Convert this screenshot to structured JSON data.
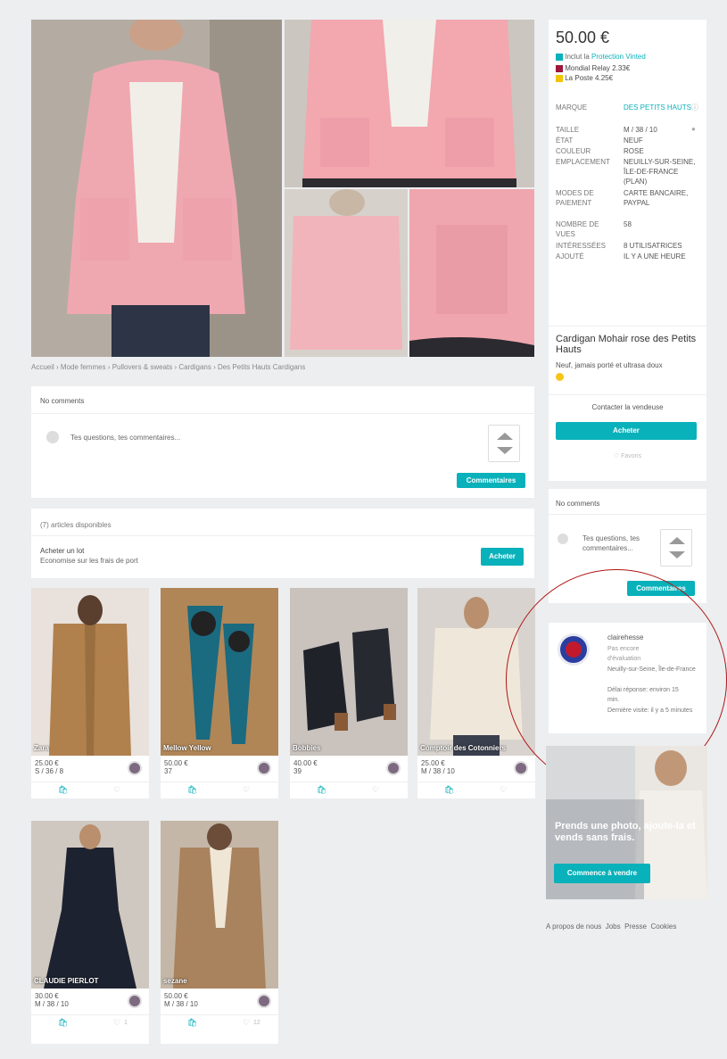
{
  "gallery": {
    "breadcrumb": "Accueil › Mode femmes › Pullovers & sweats › Cardigans › Des Petits Hauts Cardigans"
  },
  "comments_main": {
    "title": "No comments",
    "placeholder": "Tes questions, tes commentaires...",
    "button": "Commentaires"
  },
  "bundle": {
    "count": "(7) articles disponibles",
    "title": "Acheter un lot",
    "subtitle": "Economise sur les frais de port",
    "button": "Acheter"
  },
  "items": [
    {
      "brand": "Zara",
      "price": "25.00 €",
      "size": "S / 36 / 8",
      "likes": ""
    },
    {
      "brand": "Mellow Yellow",
      "price": "50.00 €",
      "size": "37",
      "likes": ""
    },
    {
      "brand": "Bobbies",
      "price": "40.00 €",
      "size": "39",
      "likes": ""
    },
    {
      "brand": "Comptoir des Cotonniers",
      "price": "25.00 €",
      "size": "M / 38 / 10",
      "likes": ""
    },
    {
      "brand": "CLAUDIE PIERLOT",
      "price": "30.00 €",
      "size": "M / 38 / 10",
      "likes": "1"
    },
    {
      "brand": "sezane",
      "price": "50.00 €",
      "size": "M / 38 / 10",
      "likes": "12"
    }
  ],
  "sidebar": {
    "price": "50.00 €",
    "protection_prefix": "Inclut la",
    "protection_link": "Protection Vinted",
    "ship1": "Mondial Relay 2.33€",
    "ship2": "La Poste 4.25€",
    "details": [
      {
        "label": "MARQUE",
        "value": "DES PETITS HAUTS"
      },
      {
        "label": "TAILLE",
        "value": "M / 38 / 10"
      },
      {
        "label": "ÉTAT",
        "value": "NEUF"
      },
      {
        "label": "COULEUR",
        "value": "ROSE"
      },
      {
        "label": "EMPLACEMENT",
        "value": "NEUILLY-SUR-SEINE, ÎLE-DE-FRANCE (PLAN)"
      },
      {
        "label": "MODES DE PAIEMENT",
        "value": "CARTE BANCAIRE, PAYPAL"
      },
      {
        "label": "NOMBRE DE VUES",
        "value": "58"
      },
      {
        "label": "INTÉRESSÉES",
        "value": "8 UTILISATRICES"
      },
      {
        "label": "AJOUTÉ",
        "value": "IL Y A UNE HEURE"
      }
    ],
    "title": "Cardigan Mohair rose des Petits Hauts",
    "description": "Neuf, jamais porté et ultrasa doux",
    "contact": "Contacter la vendeuse",
    "buy": "Acheter",
    "favorite": "♡ Favoris"
  },
  "comments_side": {
    "title": "No comments",
    "placeholder": "Tes questions, tes commentaires...",
    "button": "Commentaires"
  },
  "seller": {
    "name": "clairehesse",
    "rating": "Pas encore d'évaluation",
    "location": "Neuilly-sur-Seine, Île-de-France",
    "response": "Délai réponse: environ 15 min.",
    "last_visit": "Dernière visite: il y a 5 minutes"
  },
  "promo": {
    "text": "Prends une photo, ajoute-la et vends sans frais.",
    "button": "Commence à vendre"
  },
  "footer": {
    "links": [
      "A propos de nous",
      "Jobs",
      "Presse",
      "Cookies"
    ]
  },
  "colors": {
    "accent": "#09b1ba",
    "annotation": "#b01515"
  }
}
